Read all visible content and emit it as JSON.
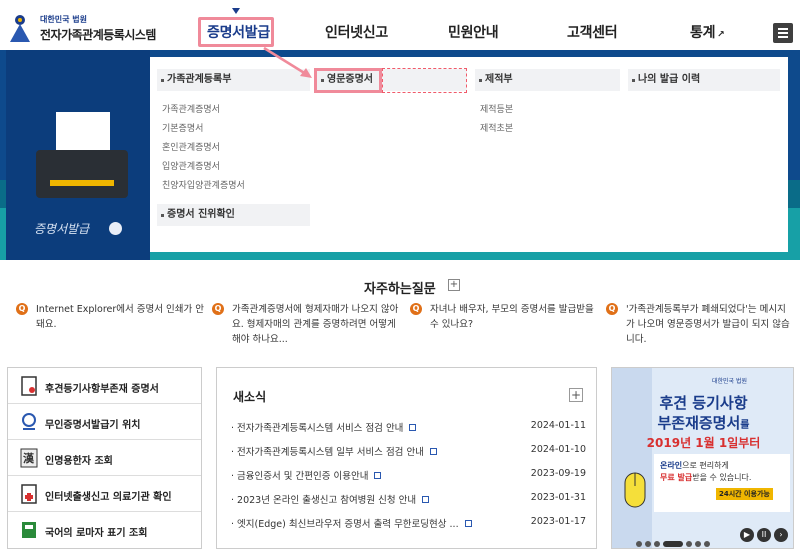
{
  "logo": {
    "line1": "대한민국 법원",
    "line2": "전자가족관계등록시스템"
  },
  "nav": [
    {
      "label": "증명서발급"
    },
    {
      "label": "인터넷신고"
    },
    {
      "label": "민원안내"
    },
    {
      "label": "고객센터"
    },
    {
      "label": "통계"
    }
  ],
  "dropdown": {
    "col1": {
      "title": "가족관계등록부",
      "items": [
        "가족관계증명서",
        "기본증명서",
        "혼인관계증명서",
        "입양관계증명서",
        "친양자입양관계증명서"
      ]
    },
    "col1b": {
      "title": "증명서 진위확인"
    },
    "col2": {
      "title": "영문증명서"
    },
    "col3": {
      "title": "제적부",
      "items": [
        "제적등본",
        "제적초본"
      ]
    },
    "col4": {
      "title": "나의 발급 이력"
    }
  },
  "hero": {
    "caption": "증명서발급"
  },
  "faq": {
    "title": "자주하는질문",
    "plus": "+",
    "items": [
      "Internet Explorer에서 증명서 인쇄가 안돼요.",
      "가족관계증명서에 형제자매가 나오지 않아요. 형제자매의 관계를 증명하려면 어떻게 해야 하나요...",
      "자녀나 배우자, 부모의 증명서를 발급받을 수 있나요?",
      "'가족관계등록부가 폐쇄되었다'는 메시지가 나오며 영문증명서가 발급이 되지 않습니다."
    ],
    "icon": "Q"
  },
  "quick": [
    {
      "label": "후견등기사항부존재 증명서",
      "icon": "certificate-icon"
    },
    {
      "label": "무인증명서발급기 위치",
      "icon": "location-icon"
    },
    {
      "label": "인명용한자 조회",
      "icon": "hanja-icon"
    },
    {
      "label": "인터넷출생신고 의료기관 확인",
      "icon": "medical-icon"
    },
    {
      "label": "국어의 로마자 표기 조회",
      "icon": "book-icon"
    }
  ],
  "news": {
    "title": "새소식",
    "plus": "+",
    "items": [
      {
        "text": "전자가족관계등록시스템 서비스 점검 안내",
        "date": "2024-01-11"
      },
      {
        "text": "전자가족관계등록시스템 일부 서비스 점검 안내",
        "date": "2024-01-10"
      },
      {
        "text": "금융인증서 및 간편인증 이용안내",
        "date": "2023-09-19"
      },
      {
        "text": "2023년 온라인 출생신고 참여병원 신청 안내",
        "date": "2023-01-31"
      },
      {
        "text": "엣지(Edge) 최신브라우저 증명서 출력 무한로딩현상 ...",
        "date": "2023-01-17"
      }
    ]
  },
  "ad": {
    "badge": "대한민국 법원",
    "l1": "후견 등기사항",
    "l2": "부존재증명서",
    "l2s": "를",
    "l3": "2019년 1월 1일부터",
    "l4a": "온라인",
    "l4b": "으로 편리하게",
    "l5a": "무료 발급",
    "l5b": "받을 수 있습니다.",
    "l6": "24시간 이용가능"
  }
}
